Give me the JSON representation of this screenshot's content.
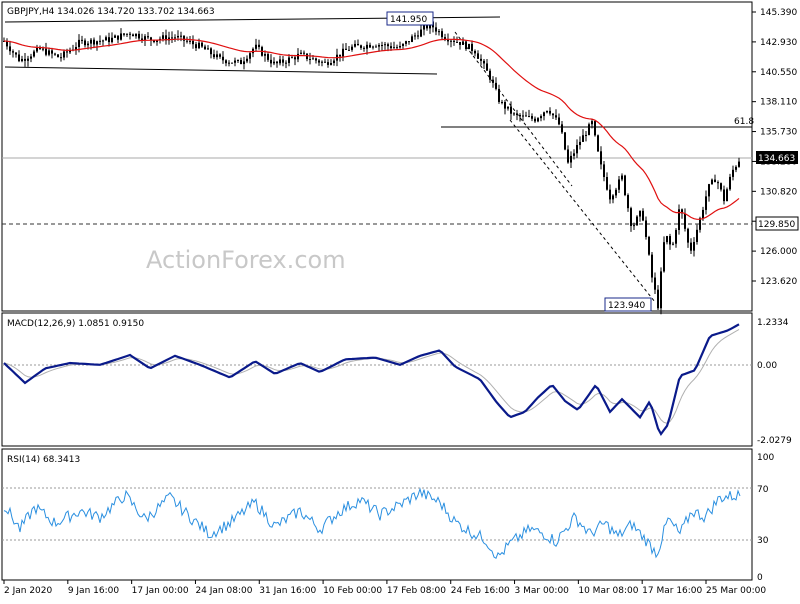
{
  "header": {
    "symbol_line": "GBPJPY,H4  134.026 134.720 133.702 134.663"
  },
  "watermark": "ActionForex.com",
  "colors": {
    "candle": "#000000",
    "ma": "#e01010",
    "macd": "#0a1a8a",
    "signal": "#b0b0b0",
    "rsi": "#2a8fe0",
    "level_box": "#1a2a8a"
  },
  "price_axis_labels": [
    "145.390",
    "142.930",
    "140.550",
    "138.110",
    "135.730",
    "133.280",
    "130.820",
    "128.370",
    "126.000",
    "123.620"
  ],
  "price_level_labels": [
    {
      "text": "134.663",
      "value": 134.663,
      "style": "current"
    },
    {
      "text": "129.850",
      "value": 129.85,
      "style": "support"
    }
  ],
  "annotations": {
    "high_label": "141.950",
    "low_label": "123.940",
    "fib_label": "61.8"
  },
  "macd": {
    "title": "MACD(12,26,9) 1.0851 0.9150",
    "axis_labels": [
      "1.2334",
      "0.00",
      "-2.0279"
    ]
  },
  "rsi": {
    "title": "RSI(14) 68.3413",
    "axis_labels": [
      "100",
      "70",
      "30",
      "0"
    ]
  },
  "time_axis_labels": [
    "2 Jan 2020",
    "9 Jan 16:00",
    "17 Jan 00:00",
    "24 Jan 08:00",
    "31 Jan 16:00",
    "10 Feb 00:00",
    "17 Feb 08:00",
    "24 Feb 16:00",
    "3 Mar 00:00",
    "10 Mar 08:00",
    "17 Mar 16:00",
    "25 Mar 00:00"
  ],
  "chart_data": {
    "type": "line",
    "series": [
      {
        "name": "GBPJPY",
        "x": [
          "2 Jan 2020",
          "9 Jan 16:00",
          "17 Jan 00:00",
          "24 Jan 08:00",
          "31 Jan 16:00",
          "10 Feb 00:00",
          "17 Feb 08:00",
          "24 Feb 16:00",
          "3 Mar 00:00",
          "10 Mar 08:00",
          "17 Mar 16:00",
          "25 Mar 00:00"
        ],
        "values": [
          143.2,
          142.9,
          143.4,
          142.2,
          141.6,
          142.3,
          143.0,
          142.8,
          137.5,
          134.0,
          127.5,
          134.663
        ]
      }
    ],
    "ylim": [
      123.6,
      145.8
    ],
    "levels": {
      "high": 141.95,
      "low": 123.94,
      "fib_61_8": 136.9,
      "support": 129.85,
      "current": 134.663
    },
    "macd": {
      "macd": 1.0851,
      "signal": 0.915,
      "ylim": [
        -2.0279,
        1.2334
      ]
    },
    "rsi": {
      "value": 68.3413,
      "ylim": [
        0,
        100
      ],
      "levels": [
        70,
        30
      ]
    }
  }
}
